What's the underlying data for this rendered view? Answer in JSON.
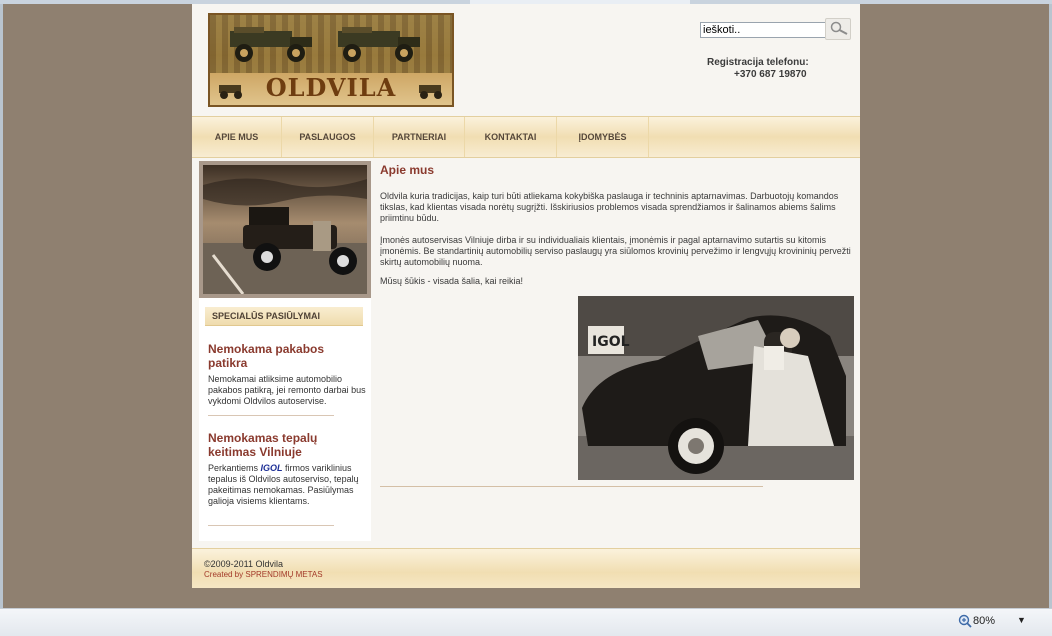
{
  "header": {
    "logo_text": "OLDVILA",
    "search_value": "ieškoti..",
    "reg_label": "Registracija telefonu:",
    "reg_phone": "+370 687 19870"
  },
  "nav": {
    "items": [
      "APIE MUS",
      "PASLAUGOS",
      "PARTNERIAI",
      "KONTAKTAI",
      "ĮDOMYBĖS"
    ]
  },
  "sidebar": {
    "special_title": "SPECIALŪS PASIŪLYMAI",
    "offer1": {
      "title": "Nemokama pakabos patikra",
      "desc": "Nemokamai atliksime automobilio pakabos patikrą, jei remonto darbai bus vykdomi Oldvilos autoservise."
    },
    "offer2": {
      "title": "Nemokamas tepalų keitimas Vilniuje",
      "desc_before": "Perkantiems ",
      "brand": "IGOL",
      "desc_after": " firmos variklinius tepalus iš Oldvilos autoserviso, tepalų pakeitimas nemokamas. Pasiūlymas galioja visiems klientams."
    }
  },
  "main": {
    "title": "Apie mus",
    "paragraphs": [
      "Oldvila kuria tradicijas, kaip turi būti atliekama kokybiška paslauga ir techninis aptarnavimas. Darbuotojų komandos tikslas, kad klientas visada norėtų sugrįžti. Išskiriusios problemos visada sprendžiamos ir šalinamos abiems šalims priimtinu būdu.",
      "Įmonės autoservisas Vilniuje dirba ir su individualiais klientais, įmonėmis ir pagal aptarnavimo sutartis su kitomis įmonėmis. Be standartinių automobilių serviso paslaugų yra siūlomos krovinių pervežimo ir lengvųjų krovininių pervežti skirtų automobilių nuoma.",
      "Mūsų šūkis - visada šalia, kai reikia!"
    ],
    "photo_sign": "IGOL"
  },
  "footer": {
    "copyright": "©2009-2011 Oldvila",
    "created": "Created by SPRENDIMŲ METAS"
  },
  "statusbar": {
    "zoom": "80%"
  },
  "colors": {
    "accent": "#8a3a2e",
    "backdrop": "#8f8070",
    "nav_bg": "#f1deb2"
  }
}
